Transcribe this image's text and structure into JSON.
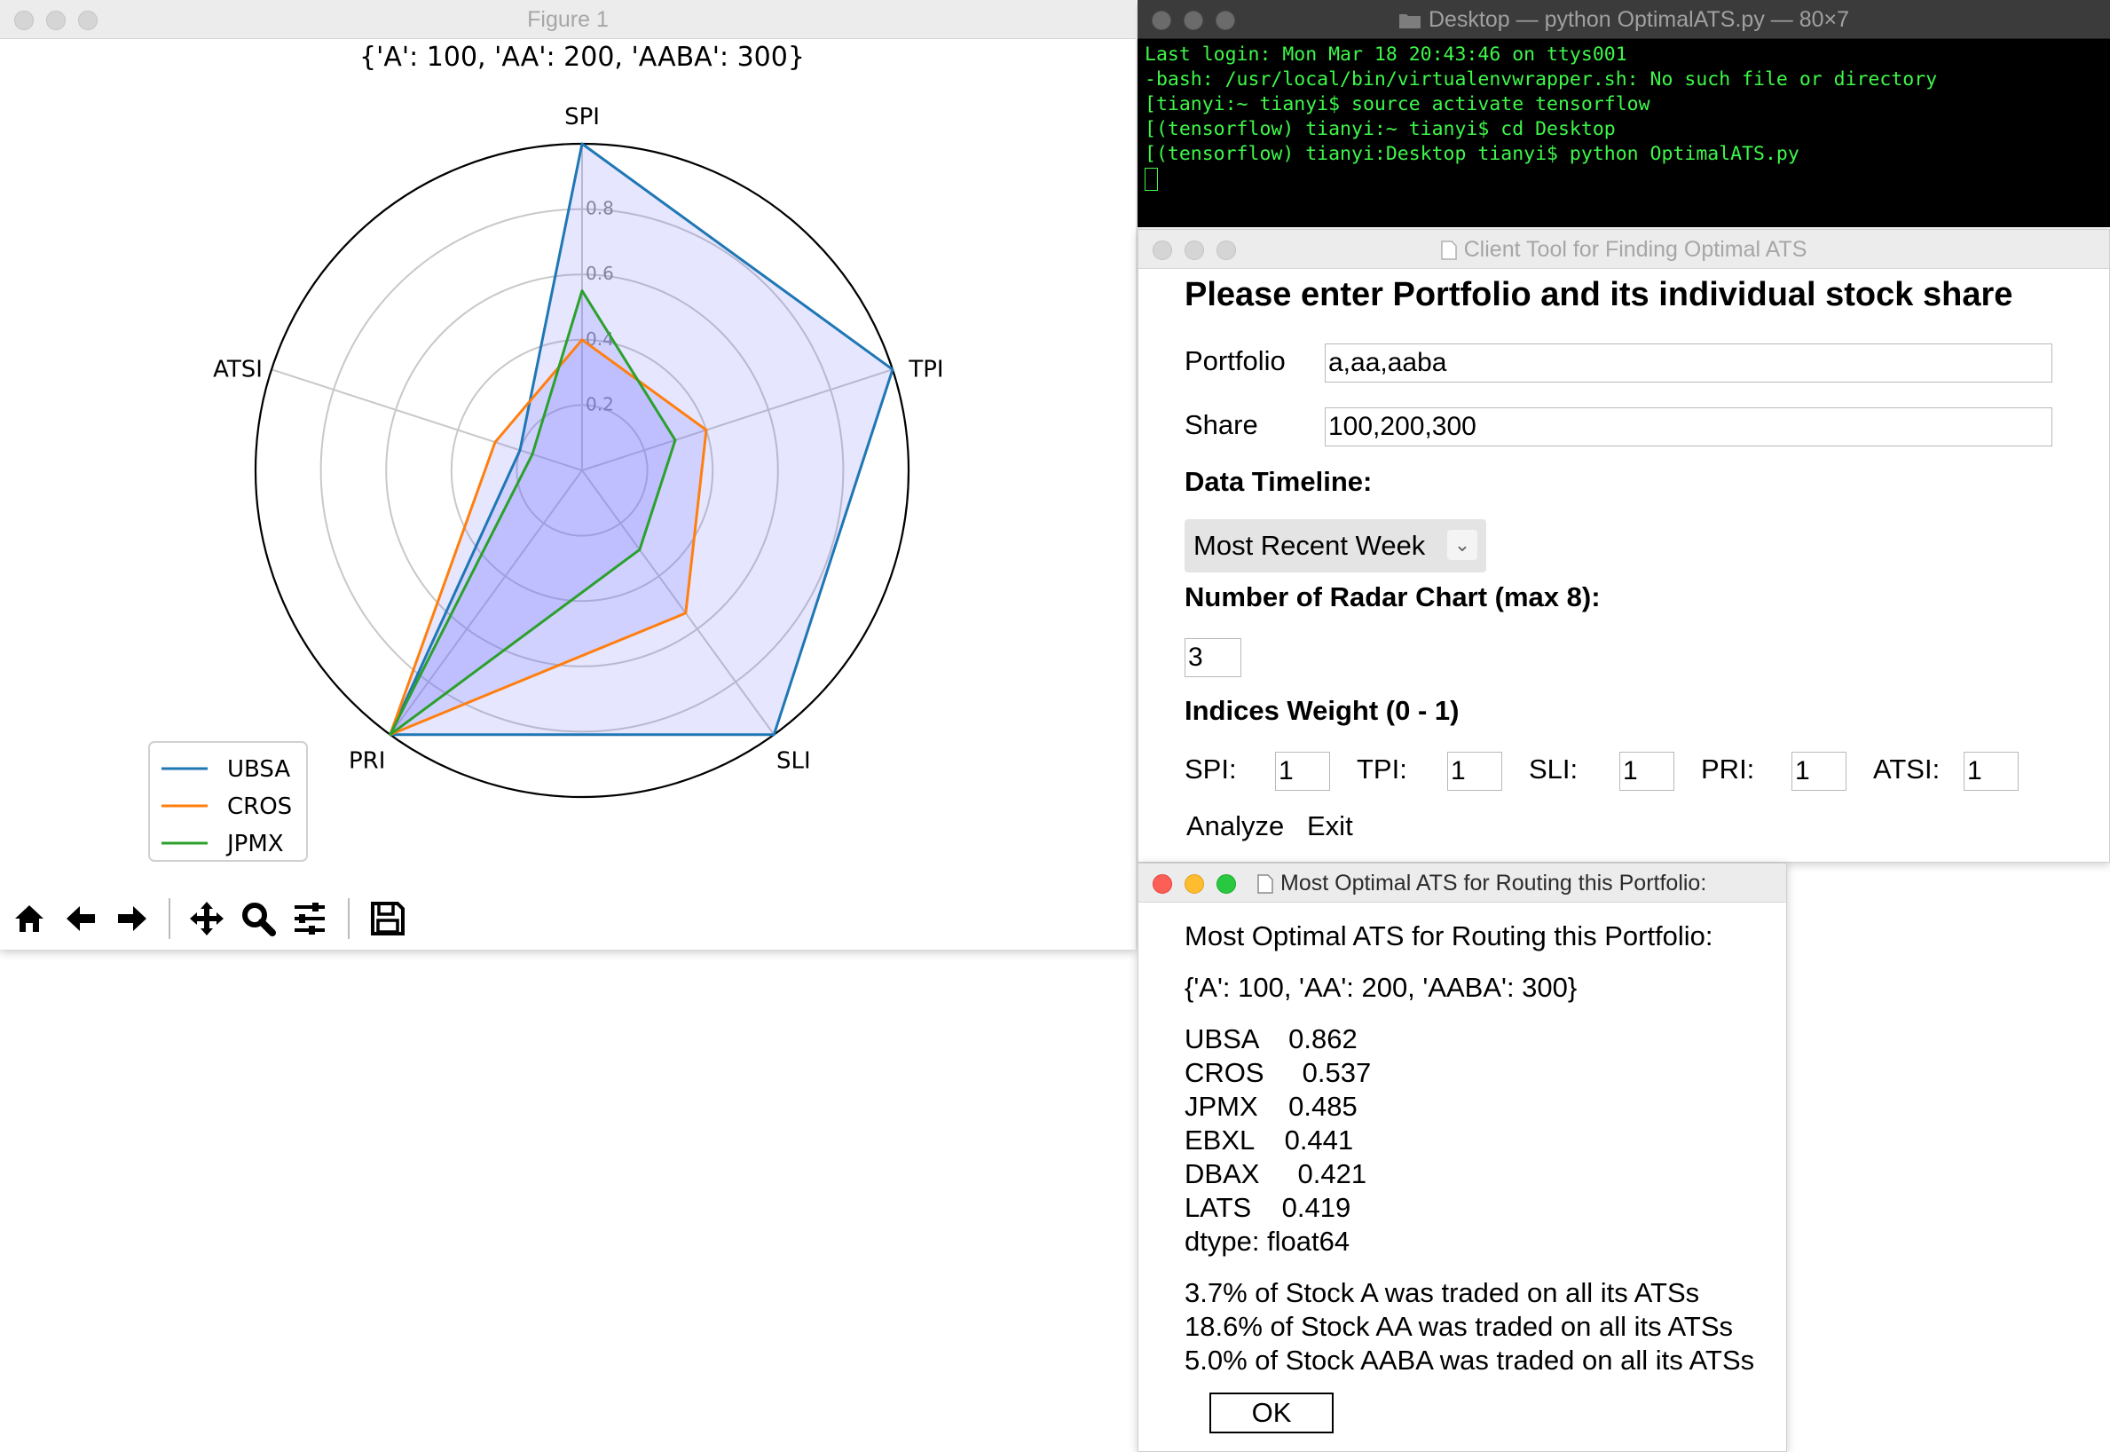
{
  "figure": {
    "window_title": "Figure 1",
    "chart_title": "{'A': 100, 'AA': 200, 'AABA': 300}"
  },
  "chart_data": {
    "type": "radar",
    "title": "{'A': 100, 'AA': 200, 'AABA': 300}",
    "axes": [
      "SPI",
      "TPI",
      "SLI",
      "PRI",
      "ATSI"
    ],
    "radial_ticks": [
      "0.2",
      "0.4",
      "0.6",
      "0.8"
    ],
    "rlim": [
      0,
      1
    ],
    "legend_position": "lower-left",
    "series": [
      {
        "name": "UBSA",
        "color": "#1f77b4",
        "values": [
          1.0,
          1.0,
          1.0,
          1.0,
          0.2
        ]
      },
      {
        "name": "CROS",
        "color": "#ff7f0e",
        "values": [
          0.4,
          0.4,
          0.54,
          1.0,
          0.28
        ]
      },
      {
        "name": "JPMX",
        "color": "#2ca02c",
        "values": [
          0.55,
          0.3,
          0.3,
          1.0,
          0.16
        ]
      }
    ],
    "fill_color": "#6b6bff"
  },
  "toolbar": {
    "buttons": [
      "home-icon",
      "back-arrow-icon",
      "forward-arrow-icon",
      "pan-icon",
      "zoom-icon",
      "configure-subplots-icon",
      "save-icon"
    ]
  },
  "terminal": {
    "title": "Desktop — python OptimalATS.py — 80×7",
    "lines": [
      "Last login: Mon Mar 18 20:43:46 on ttys001",
      "-bash: /usr/local/bin/virtualenvwrapper.sh: No such file or directory",
      "[tianyi:~ tianyi$ source activate tensorflow",
      "[(tensorflow) tianyi:~ tianyi$ cd Desktop",
      "[(tensorflow) tianyi:Desktop tianyi$ python OptimalATS.py"
    ]
  },
  "client": {
    "title": "Client Tool for Finding Optimal ATS",
    "heading": "Please enter Portfolio and its individual stock share",
    "portfolio_label": "Portfolio",
    "portfolio_value": "a,aa,aaba",
    "share_label": "Share",
    "share_value": "100,200,300",
    "timeline_label": "Data Timeline:",
    "timeline_value": "Most Recent Week",
    "radar_label": "Number of Radar Chart (max 8):",
    "radar_value": "3",
    "weights_label": "Indices Weight (0 - 1)",
    "weights": [
      {
        "label": "SPI:",
        "value": "1"
      },
      {
        "label": "TPI:",
        "value": "1"
      },
      {
        "label": "SLI:",
        "value": "1"
      },
      {
        "label": "PRI:",
        "value": "1"
      },
      {
        "label": "ATSI:",
        "value": "1"
      }
    ],
    "analyze_label": "Analyze",
    "exit_label": "Exit"
  },
  "result": {
    "title": "Most Optimal ATS for Routing this Portfolio:",
    "heading": "Most Optimal ATS for Routing this Portfolio:",
    "portfolio": "{'A': 100, 'AA': 200, 'AABA': 300}",
    "scores": [
      "UBSA    0.862",
      "CROS     0.537",
      "JPMX    0.485",
      "EBXL    0.441",
      "DBAX     0.421",
      "LATS    0.419"
    ],
    "dtype": "dtype: float64",
    "traded": [
      "3.7% of Stock A was traded on all its ATSs",
      "18.6% of Stock AA was traded on all its ATSs",
      "5.0% of Stock AABA was traded on all its ATSs"
    ],
    "ok_label": "OK"
  }
}
